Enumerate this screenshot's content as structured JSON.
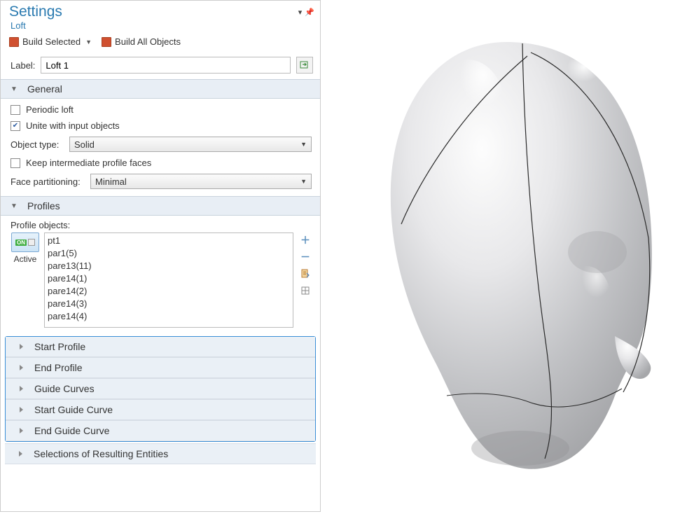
{
  "panel": {
    "title": "Settings",
    "subtitle": "Loft"
  },
  "toolbar": {
    "build_selected": "Build Selected",
    "build_all": "Build All Objects"
  },
  "label_field": {
    "label": "Label:",
    "value": "Loft 1"
  },
  "sections": {
    "general": {
      "title": "General",
      "periodic_loft": {
        "label": "Periodic loft",
        "checked": false
      },
      "unite_inputs": {
        "label": "Unite with input objects",
        "checked": true
      },
      "object_type": {
        "label": "Object type:",
        "value": "Solid"
      },
      "keep_faces": {
        "label": "Keep intermediate profile faces",
        "checked": false
      },
      "face_part": {
        "label": "Face partitioning:",
        "value": "Minimal"
      }
    },
    "profiles": {
      "title": "Profiles",
      "objects_label": "Profile objects:",
      "active_label": "Active",
      "on_badge": "ON",
      "items": [
        "pt1",
        "par1(5)",
        "pare13(11)",
        "pare14(1)",
        "pare14(2)",
        "pare14(3)",
        "pare14(4)"
      ]
    },
    "start_profile": "Start Profile",
    "end_profile": "End Profile",
    "guide_curves": "Guide Curves",
    "start_guide_curve": "Start Guide Curve",
    "end_guide_curve": "End Guide Curve",
    "selections": "Selections of Resulting Entities"
  }
}
